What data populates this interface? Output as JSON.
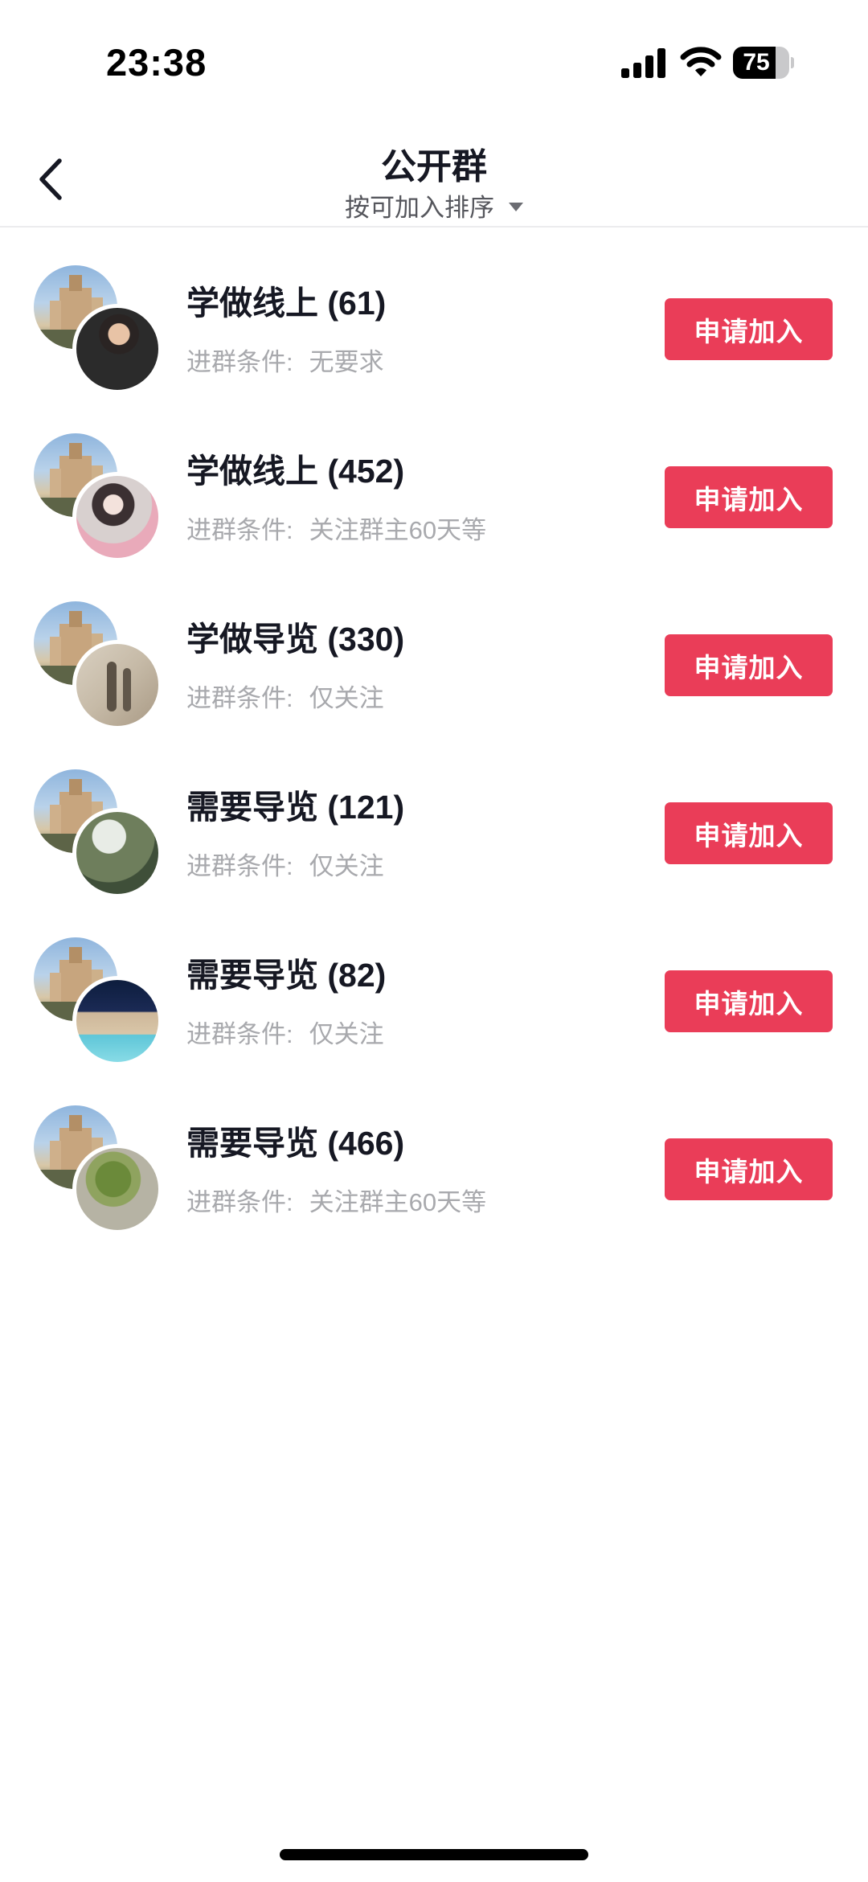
{
  "status_bar": {
    "time": "23:38",
    "battery_level": "75",
    "battery_fraction": 0.75,
    "icons": [
      "signal-icon",
      "wifi-icon",
      "battery-icon"
    ]
  },
  "nav": {
    "back_icon": "chevron-left-icon",
    "title": "公开群",
    "sort_label": "按可加入排序",
    "sort_caret_icon": "caret-down-icon"
  },
  "colors": {
    "accent": "#ea3d58",
    "text_primary": "#161823",
    "text_secondary": "#a8a9ad",
    "background": "#ffffff"
  },
  "groups": [
    {
      "name": "学做线上 (61)",
      "condition_label": "进群条件:",
      "condition_value": "无要求",
      "button_label": "申请加入"
    },
    {
      "name": "学做线上 (452)",
      "condition_label": "进群条件:",
      "condition_value": "关注群主60天等",
      "button_label": "申请加入"
    },
    {
      "name": "学做导览 (330)",
      "condition_label": "进群条件:",
      "condition_value": "仅关注",
      "button_label": "申请加入"
    },
    {
      "name": "需要导览 (121)",
      "condition_label": "进群条件:",
      "condition_value": "仅关注",
      "button_label": "申请加入"
    },
    {
      "name": "需要导览 (82)",
      "condition_label": "进群条件:",
      "condition_value": "仅关注",
      "button_label": "申请加入"
    },
    {
      "name": "需要导览 (466)",
      "condition_label": "进群条件:",
      "condition_value": "关注群主60天等",
      "button_label": "申请加入"
    }
  ]
}
